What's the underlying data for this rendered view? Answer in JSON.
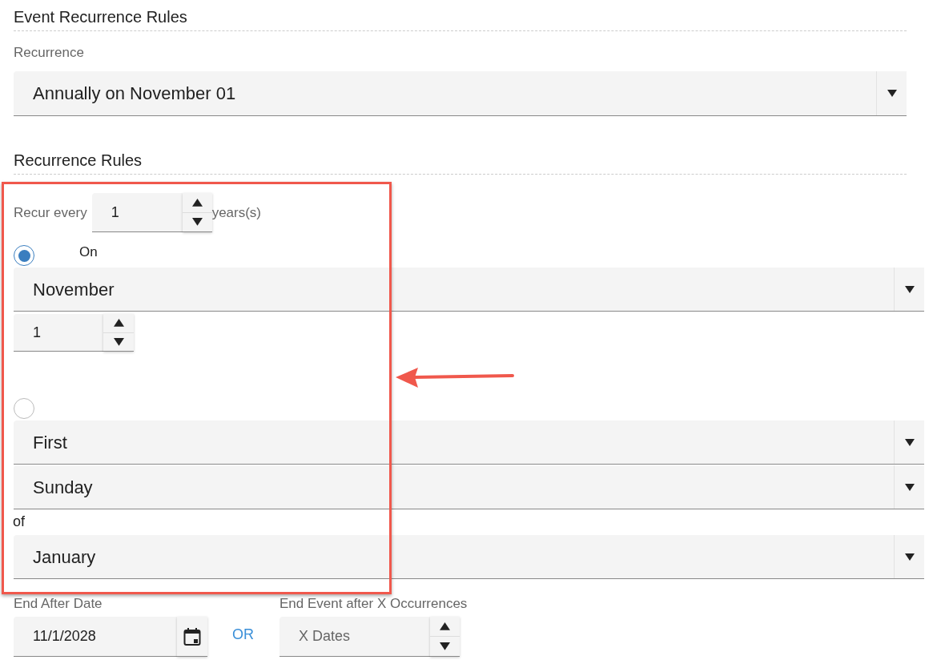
{
  "section_title": "Event Recurrence Rules",
  "recurrence": {
    "label": "Recurrence",
    "value": "Annually on November 01"
  },
  "rules": {
    "title": "Recurrence Rules",
    "recur_every": {
      "label": "Recur every",
      "value": "1",
      "unit": "years(s)"
    },
    "options": [
      {
        "selected": true,
        "label": "On",
        "fields": [
          {
            "kind": "select",
            "value": "November"
          },
          {
            "kind": "spinner",
            "value": "1"
          }
        ]
      },
      {
        "selected": false,
        "fields": [
          {
            "kind": "select",
            "value": "First"
          },
          {
            "kind": "select",
            "value": "Sunday"
          },
          {
            "kind": "text",
            "value": "of"
          },
          {
            "kind": "select",
            "value": "January"
          }
        ]
      }
    ]
  },
  "end": {
    "date": {
      "label": "End After Date",
      "value": "11/1/2028"
    },
    "separator": "OR",
    "occurrences": {
      "label": "End Event after X Occurrences",
      "placeholder": "X Dates"
    }
  }
}
